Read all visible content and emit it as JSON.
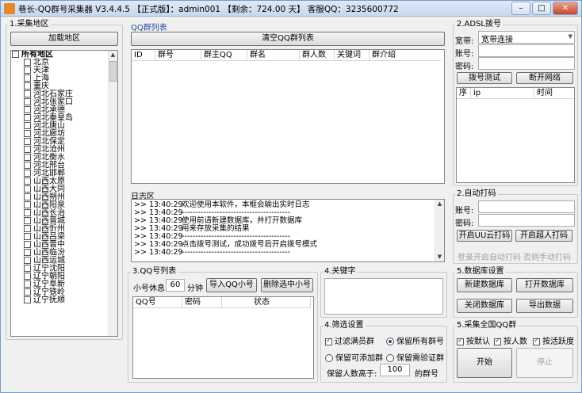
{
  "window": {
    "title": "巷长-QQ群号采集器 V3.4.4.5 【正式版】：admin001 【剩余：724.00 天】 客服QQ：3235600772",
    "controls": [
      "–",
      "□",
      "✕"
    ]
  },
  "region": {
    "group_label": "1.采集地区",
    "load_button": "加载地区",
    "items": [
      "所有地区",
      "北京",
      "天津",
      "上海",
      "重庆",
      "河北石家庄",
      "河北张家口",
      "河北承德",
      "河北秦皇岛",
      "河北唐山",
      "河北廊坊",
      "河北保定",
      "河北沧州",
      "河北衡水",
      "河北邢台",
      "河北邯郸",
      "山西太原",
      "山西大同",
      "山西朔州",
      "山西阳泉",
      "山西长治",
      "山西晋城",
      "山西忻州",
      "山西吕梁",
      "山西晋中",
      "山西临汾",
      "山西运城",
      "辽宁沈阳",
      "辽宁朝阳",
      "辽宁阜新",
      "辽宁铁岭",
      "辽宁抚顺"
    ]
  },
  "qq_list": {
    "label": "QQ群列表",
    "clear_button": "清空QQ群列表",
    "columns": [
      "ID",
      "群号",
      "群主QQ",
      "群名",
      "群人数",
      "关键词",
      "群介绍"
    ]
  },
  "log": {
    "label": "日志区",
    "lines": [
      {
        "ts": ">> 13:40:29",
        "msg": "欢迎使用本软件，本框会输出实时日志"
      },
      {
        "ts": ">> 13:40:29",
        "msg": "----------------------------------------"
      },
      {
        "ts": ">> 13:40:29",
        "msg": "使用前请新建数据库，并打开数据库"
      },
      {
        "ts": ">> 13:40:29",
        "msg": "用来存放采集的结果"
      },
      {
        "ts": ">> 13:40:29",
        "msg": "----------------------------------------"
      },
      {
        "ts": ">> 13:40:29",
        "msg": "点击拨号测试，成功拨号后开启拨号模式"
      },
      {
        "ts": ">> 13:40:29",
        "msg": "----------------------------------------"
      }
    ]
  },
  "qq_numbers": {
    "group_label": "3.QQ号列表",
    "rest_label": "小号休息",
    "rest_value": "60",
    "rest_unit": "分钟",
    "import_button": "导入QQ小号",
    "delete_button": "删除选中小号",
    "columns": [
      "QQ号",
      "密码",
      "状态"
    ]
  },
  "keywords": {
    "group_label": "4.关键字"
  },
  "filter": {
    "group_label": "4.筛选设置",
    "filter_full": "过滤满员群",
    "keep_all": "保留所有群号",
    "keep_joinable": "保留可添加群",
    "keep_verify": "保留需验证群",
    "min_members_label": "保留人数高于:",
    "min_members_value": "100",
    "min_members_unit": "的群号"
  },
  "adsl": {
    "group_label": "2.ADSL拨号",
    "broadband_label": "宽带:",
    "broadband_value": "宽带连接",
    "account_label": "账号:",
    "password_label": "密码:",
    "dial_test_button": "拨号测试",
    "disconnect_button": "断开网络",
    "columns": [
      "序",
      "ip",
      "时间"
    ]
  },
  "captcha": {
    "group_label": "2.自动打码",
    "account_label": "账号:",
    "password_label": "密码:",
    "uu_button": "开启UU云打码",
    "super_button": "开启超人打码",
    "hint_login": "登录开启自动打码",
    "hint_manual": "否则手动打码"
  },
  "database": {
    "group_label": "5.数据库设置",
    "new_button": "新建数据库",
    "open_button": "打开数据库",
    "close_button": "关闭数据库",
    "export_button": "导出数据"
  },
  "collect_all": {
    "group_label": "5.采集全国QQ群",
    "by_default": "按默认",
    "by_members": "按人数",
    "by_activity": "按活跃度",
    "start_button": "开始",
    "stop_button": "停止"
  }
}
